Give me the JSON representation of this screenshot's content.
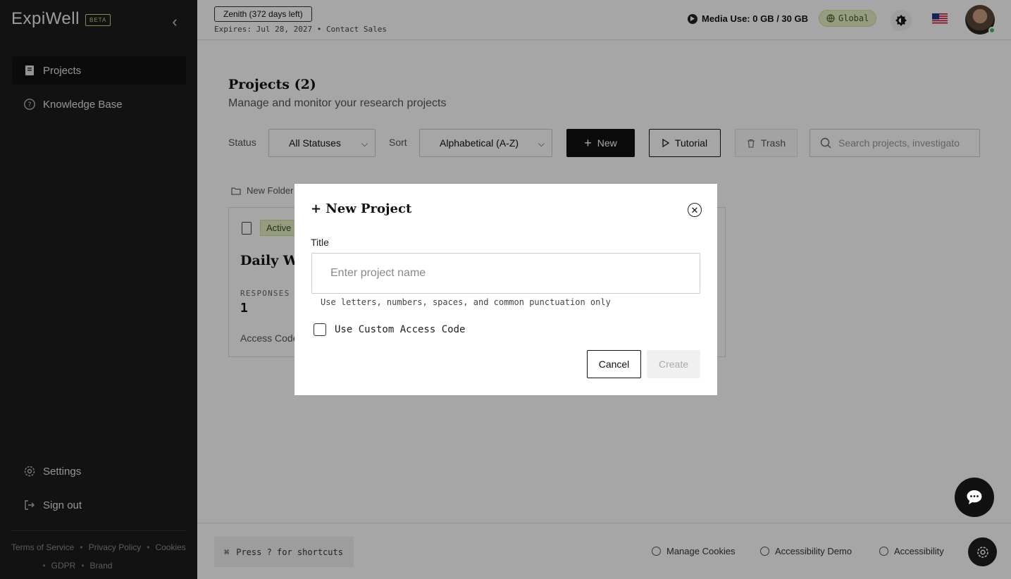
{
  "app": {
    "logo": "ExpiWell",
    "beta_label": "BETA"
  },
  "sidebar": {
    "items": [
      {
        "label": "Projects",
        "icon": "book-icon",
        "active": true
      },
      {
        "label": "Knowledge Base",
        "icon": "help-circle-icon",
        "active": false
      }
    ],
    "bottom_items": [
      {
        "label": "Settings",
        "icon": "gear-icon"
      },
      {
        "label": "Sign out",
        "icon": "sign-out-icon"
      }
    ],
    "footer_links": {
      "terms": "Terms of Service",
      "privacy": "Privacy Policy",
      "cookies": "Cookies",
      "gdpr": "GDPR",
      "brand": "Brand",
      "separator": "•"
    }
  },
  "topbar": {
    "plan_badge": "Zenith (372 days left)",
    "expires": "Expires: Jul 28, 2027 • Contact Sales",
    "media_use": "Media Use: 0 GB / 30 GB",
    "region": "Global",
    "accent_color": "#e6f0c6"
  },
  "main": {
    "title": "Projects (2)",
    "subtitle": "Manage and monitor your research projects",
    "status_label": "Status",
    "status_value": "All Statuses",
    "sort_label": "Sort",
    "sort_value": "Alphabetical (A-Z)",
    "new_label": "New",
    "tutorial_label": "Tutorial",
    "trash_label": "Trash",
    "search_placeholder": "Search projects, investigato",
    "new_folder_label": "New Folder",
    "card": {
      "badge": "Active",
      "title": "Daily Wel",
      "responses_label": "RESPONSES",
      "responses_value": "1",
      "access_label": "Access Code"
    }
  },
  "bottombar": {
    "shortcuts_icon": "⌘",
    "shortcuts": "Press ? for shortcuts",
    "manage_cookies": "Manage Cookies",
    "accessibility_demo": "Accessibility Demo",
    "accessibility": "Accessibility"
  },
  "modal": {
    "title": "+ New Project",
    "title_label": "Title",
    "title_placeholder": "Enter project name",
    "title_value": "",
    "hint": "Use letters, numbers, spaces, and common punctuation only",
    "custom_code_label": "Use Custom Access Code",
    "custom_code_checked": false,
    "cancel_label": "Cancel",
    "create_label": "Create"
  }
}
